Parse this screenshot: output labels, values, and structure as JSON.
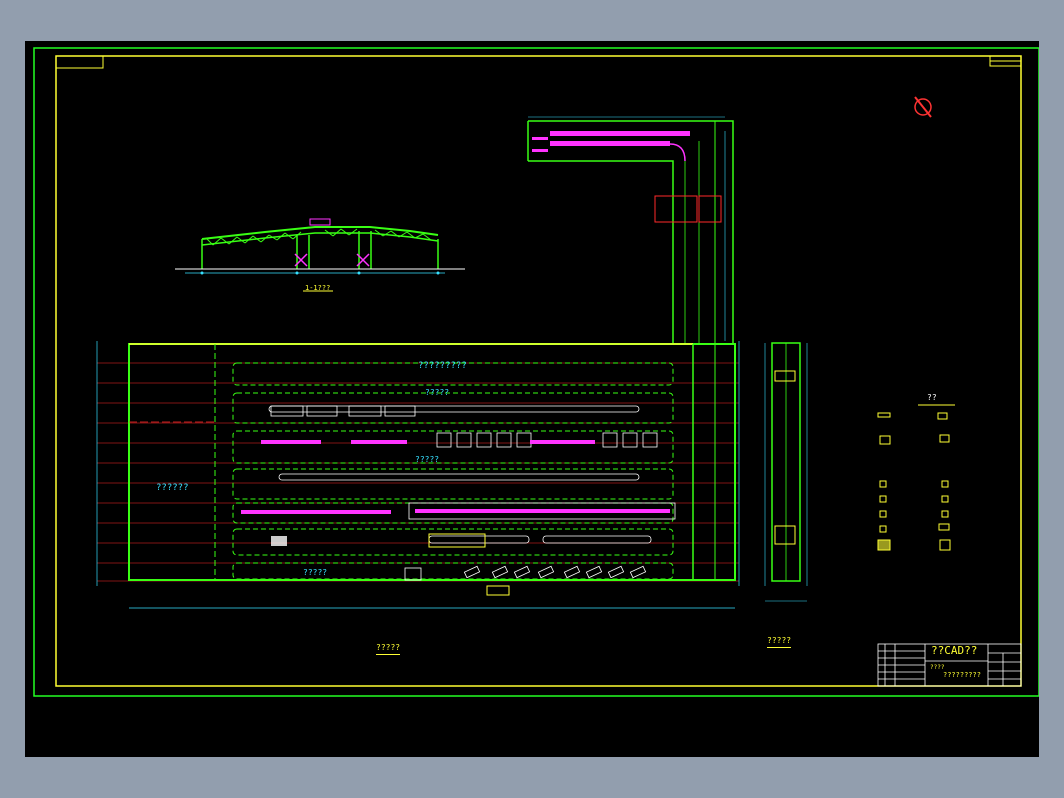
{
  "labels": {
    "section_caption": "1-1???",
    "top_zone": "?????????",
    "zone_a": "?????",
    "zone_b": "?????",
    "zone_c": "?????",
    "left_zone": "??????",
    "plan_caption": "?????",
    "side_caption": "?????",
    "legend_title": "??"
  },
  "title_block": {
    "logo": "??CAD??",
    "line1": "????",
    "line2": "?????????"
  },
  "colors": {
    "sheet": "#000000",
    "frame": "#ffff33",
    "border_green": "#22ff22",
    "wall": "#39ff14",
    "text_cyan": "#36e0ff",
    "conveyor": "#ff33ff",
    "axis_red": "#ff2a2a",
    "outer_bg": "#929eae"
  },
  "icons": {
    "north_arrow": "north-arrow-icon"
  }
}
